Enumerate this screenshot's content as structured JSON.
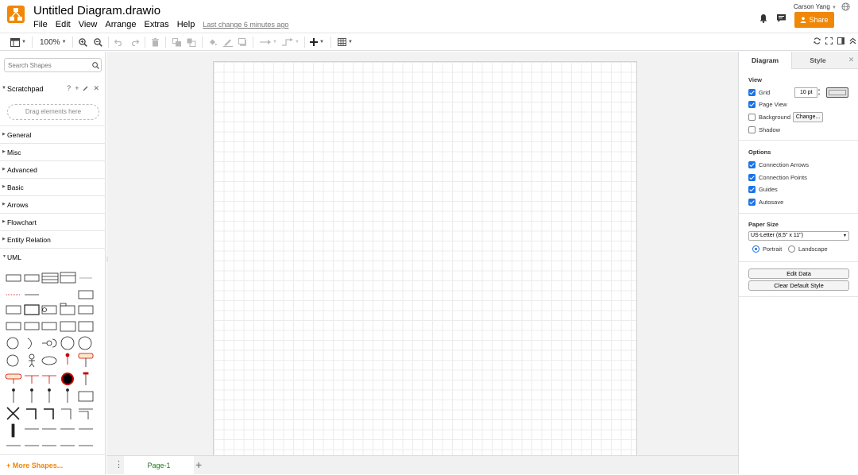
{
  "app": {
    "title": "Untitled Diagram.drawio",
    "menu": [
      "File",
      "Edit",
      "View",
      "Arrange",
      "Extras",
      "Help"
    ],
    "last_change": "Last change 6 minutes ago",
    "user": "Carson Yang",
    "share_label": "Share",
    "accent": "#f08705"
  },
  "toolbar": {
    "zoom": "100%"
  },
  "left": {
    "search_placeholder": "Search Shapes",
    "scratchpad": {
      "label": "Scratchpad",
      "help": "?",
      "add": "+",
      "close": "✕",
      "drop_hint": "Drag elements here"
    },
    "categories": [
      "General",
      "Misc",
      "Advanced",
      "Basic",
      "Arrows",
      "Flowchart",
      "Entity Relation",
      "UML"
    ],
    "more_shapes": "+ More Shapes..."
  },
  "pages": {
    "tabs": [
      "Page-1"
    ]
  },
  "right": {
    "tabs": [
      "Diagram",
      "Style"
    ],
    "view": {
      "title": "View",
      "grid": {
        "label": "Grid",
        "checked": true,
        "size": "10 pt"
      },
      "page_view": {
        "label": "Page View",
        "checked": true
      },
      "background": {
        "label": "Background",
        "checked": false,
        "button": "Change..."
      },
      "shadow": {
        "label": "Shadow",
        "checked": false
      }
    },
    "options": {
      "title": "Options",
      "items": [
        {
          "label": "Connection Arrows",
          "checked": true
        },
        {
          "label": "Connection Points",
          "checked": true
        },
        {
          "label": "Guides",
          "checked": true
        },
        {
          "label": "Autosave",
          "checked": true
        }
      ]
    },
    "paper": {
      "title": "Paper Size",
      "size": "US-Letter (8,5\" x 11\")",
      "portrait": "Portrait",
      "landscape": "Landscape",
      "orientation": "portrait"
    },
    "buttons": {
      "edit_data": "Edit Data",
      "clear_style": "Clear Default Style"
    }
  }
}
